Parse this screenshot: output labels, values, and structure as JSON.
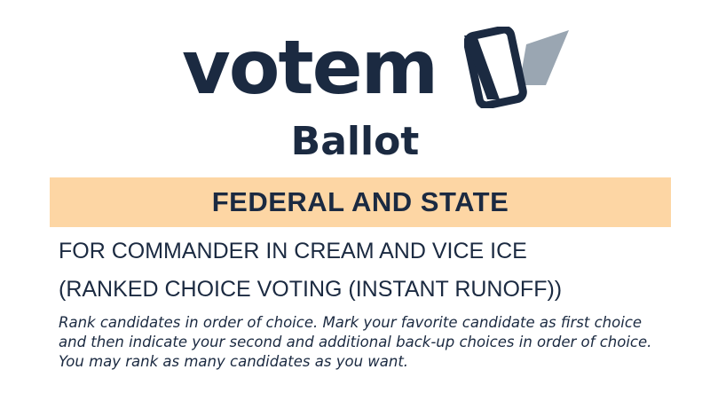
{
  "brand": {
    "wordmark": "votem",
    "colors": {
      "navy": "#1b2a41",
      "check_grey": "#9aa6b2",
      "band": "#fdd6a4"
    },
    "mark_icon": "phone-checkmark-icon"
  },
  "ballot": {
    "title": "Ballot"
  },
  "section": {
    "title": "FEDERAL AND STATE"
  },
  "contest": {
    "title": "FOR COMMANDER IN CREAM AND VICE ICE",
    "method": "(RANKED CHOICE VOTING (INSTANT RUNOFF))",
    "instructions": "Rank candidates in order of choice. Mark your favorite candidate as first choice and then indicate your second and additional back-up choices in order of choice. You may rank as many candidates as you want."
  }
}
